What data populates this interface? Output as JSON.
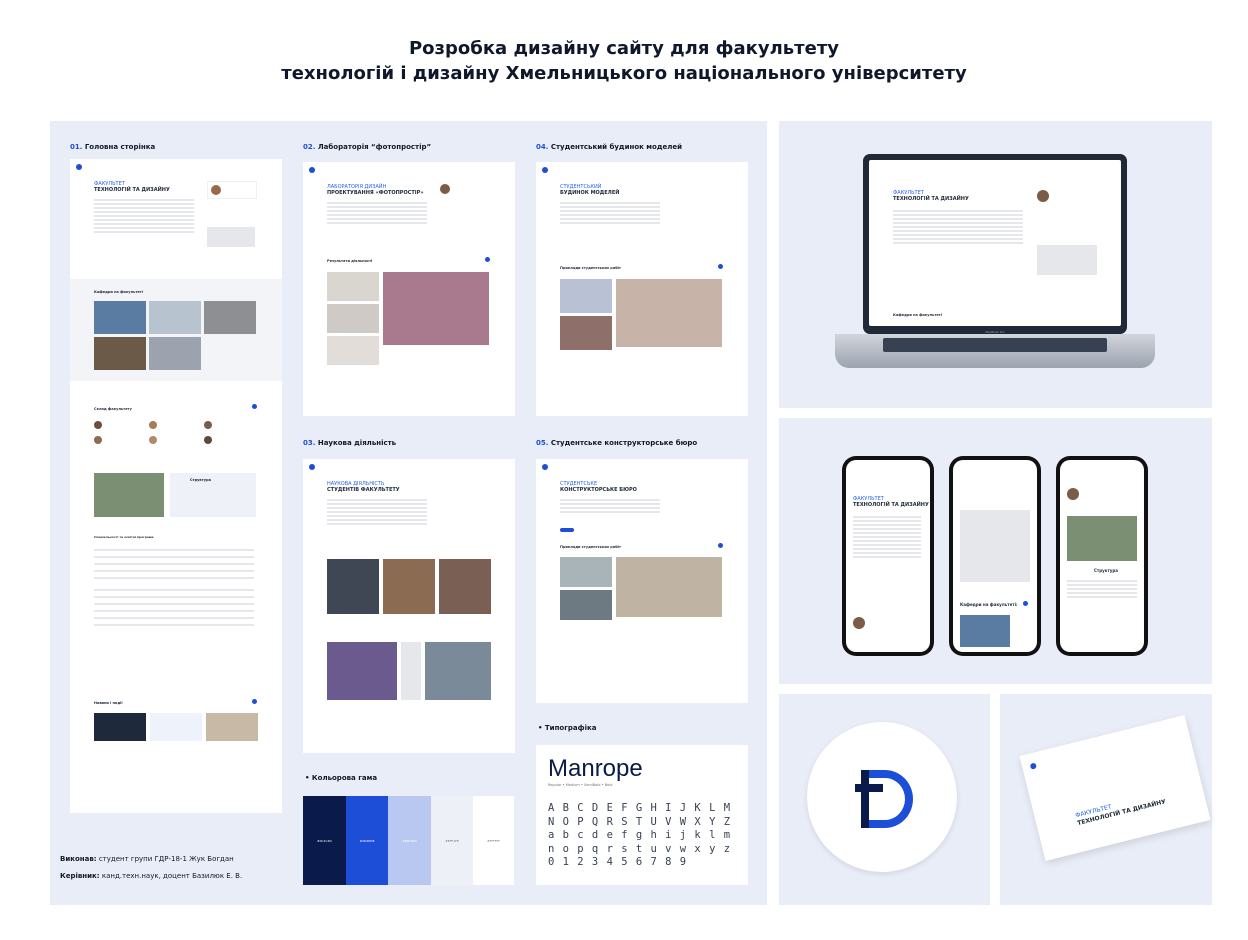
{
  "page": {
    "title_line1": "Розробка дизайну сайту для факультету",
    "title_line2": "технологій і дизайну Хмельницького національного університету"
  },
  "sections": [
    {
      "num": "01.",
      "label": "Головна сторінка"
    },
    {
      "num": "02.",
      "label": "Лабораторія “фотопростір”"
    },
    {
      "num": "04.",
      "label": "Студентський будинок моделей"
    },
    {
      "num": "03.",
      "label": "Наукова діяльність"
    },
    {
      "num": "05.",
      "label": "Студентське конструкторське бюро"
    }
  ],
  "mockups": {
    "home": {
      "title_a": "ФАКУЛЬТЕТ",
      "title_b": "ТЕХНОЛОГІЙ ТА ДИЗАЙНУ",
      "block1": "Кафедри на факультеті",
      "block2": "Склад факультету",
      "block3": "Структура",
      "block4": "Спеціальності та освітні програми",
      "block5": "Новини і події"
    },
    "lab": {
      "title_a": "ЛАБОРАТОРІЯ ДИЗАЙН",
      "title_b": "ПРОЕКТУВАННЯ «ФОТОПРОСТІР»",
      "block": "Результати діяльності"
    },
    "models": {
      "title_a": "СТУДЕНТСЬКИЙ",
      "title_b": "БУДИНОК МОДЕЛЕЙ",
      "block": "Приклади студентських робіт"
    },
    "science": {
      "title_a": "НАУКОВА ДІЯЛЬНІСТЬ",
      "title_b": "СТУДЕНТІВ ФАКУЛЬТЕТУ"
    },
    "bureau": {
      "title_a": "СТУДЕНТСЬКЕ",
      "title_b": "КОНСТРУКТОРСЬКЕ БЮРО",
      "block": "Приклади студентських робіт"
    }
  },
  "palette": {
    "label": "• Кольорова гама",
    "swatches": [
      {
        "hex": "#0a1a4a",
        "code": "#0C1C4D"
      },
      {
        "hex": "#1d4ed8",
        "code": "#2D4ED8"
      },
      {
        "hex": "#b9c8f0",
        "code": "#BBC8F0"
      },
      {
        "hex": "#edf0f7",
        "code": "#EFF1F8"
      },
      {
        "hex": "#ffffff",
        "code": "#FFFFFF"
      }
    ]
  },
  "typography": {
    "label": "• Типографіка",
    "font_name": "Manrope",
    "weights": "Regular • Medium • SemiBold • Bold",
    "rows": [
      "A B C D E F G H I J K L M",
      "N O P Q R S T U V W X Y Z",
      "a b c d e f g h i j k l m",
      "n o p q r s t u v w x y z",
      "0 1 2 3 4 5 6 7 8 9"
    ]
  },
  "laptop": {
    "title_a": "ФАКУЛЬТЕТ",
    "title_b": "ТЕХНОЛОГІЙ ТА ДИЗАЙНУ",
    "block": "Кафедри на факультеті",
    "brand": "MacBook Pro"
  },
  "phones": {
    "p1_title_a": "ФАКУЛЬТЕТ",
    "p1_title_b": "ТЕХНОЛОГІЙ ТА ДИЗАЙНУ",
    "p2_block": "Кафедри на факультеті:",
    "p3_block": "Структура"
  },
  "card": {
    "title_a": "ФАКУЛЬТЕТ",
    "title_b": "ТЕХНОЛОГІЙ ТА ДИЗАЙНУ"
  },
  "credits": {
    "author_label": "Виконав:",
    "author": "студент групи ГДР-18-1 Жук Богдан",
    "advisor_label": "Керівник:",
    "advisor": "канд.техн.наук, доцент Базилюк Е. В."
  },
  "colors": {
    "accent": "#1d4ed8",
    "navy": "#0a1a4a",
    "panel": "#e9edf8"
  }
}
